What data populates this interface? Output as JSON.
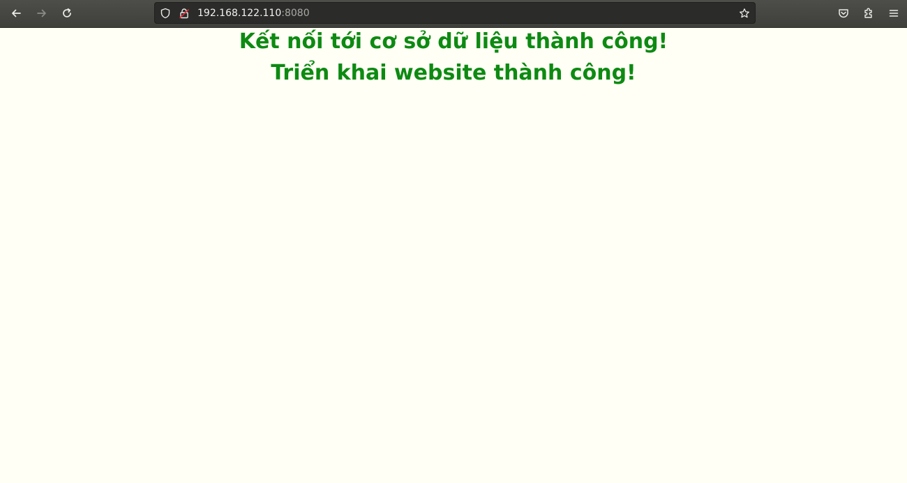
{
  "browser": {
    "address_bar": {
      "host": "192.168.122.110",
      "port": ":8080"
    },
    "icons": {
      "back": "arrow-left-icon",
      "forward": "arrow-right-icon",
      "reload": "reload-icon",
      "tracking_protection": "shield-icon",
      "connection_insecure": "lock-insecure-icon",
      "bookmark": "star-icon",
      "pocket": "pocket-icon",
      "extensions": "puzzle-icon",
      "menu": "hamburger-menu-icon"
    }
  },
  "page": {
    "background": "#fffff5",
    "text_color": "#0d8a12",
    "line1": "Kết nối tới cơ sở dữ liệu thành công!",
    "line2": "Triển khai website thành công!"
  }
}
